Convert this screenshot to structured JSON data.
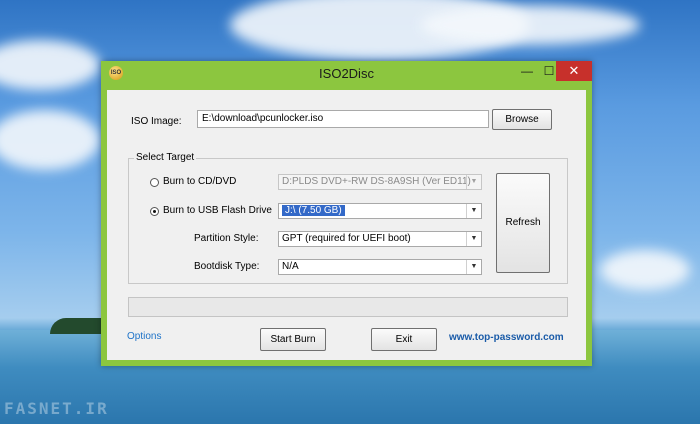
{
  "window": {
    "title": "ISO2Disc",
    "icon_label": "ISO",
    "minimize": "—",
    "maximize": "☐",
    "close": "✕"
  },
  "iso": {
    "label": "ISO Image:",
    "value": "E:\\download\\pcunlocker.iso",
    "browse": "Browse"
  },
  "target": {
    "group_label": "Select Target",
    "cd_label": "Burn to CD/DVD",
    "cd_selected": false,
    "cd_drive": "D:PLDS DVD+-RW DS-8A9SH (Ver ED11)",
    "usb_label": "Burn to USB Flash Drive",
    "usb_selected": true,
    "usb_drive": "J:\\ (7.50 GB)",
    "partition_label": "Partition Style:",
    "partition_value": "GPT (required for UEFI boot)",
    "bootdisk_label": "Bootdisk Type:",
    "bootdisk_value": "N/A",
    "refresh": "Refresh"
  },
  "progress": {
    "value": 0
  },
  "footer": {
    "options": "Options",
    "start": "Start Burn",
    "exit": "Exit",
    "website": "www.top-password.com"
  },
  "desktop": {
    "watermark": "FASNET.IR"
  },
  "colors": {
    "window_frame": "#8cc63f",
    "close_button": "#c7302b",
    "selection": "#3369c8",
    "link": "#1e73c8"
  }
}
